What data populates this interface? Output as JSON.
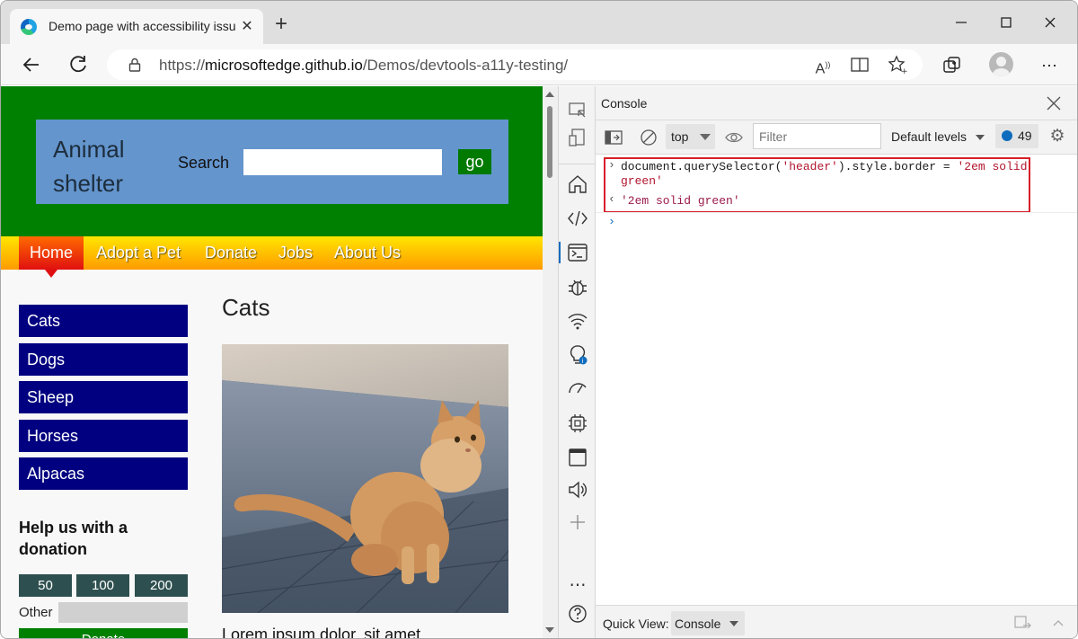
{
  "browser": {
    "tab_title": "Demo page with accessibility issues",
    "tab_close": "✕",
    "new_tab": "+",
    "url_scheme": "https://",
    "url_host": "microsoftedge.github.io",
    "url_path": "/Demos/devtools-a11y-testing/"
  },
  "page": {
    "site_title": "Animal shelter",
    "search_label": "Search",
    "search_value": "",
    "go_label": "go",
    "nav": [
      "Home",
      "Adopt a Pet",
      "Donate",
      "Jobs",
      "About Us"
    ],
    "sidebar": [
      "Cats",
      "Dogs",
      "Sheep",
      "Horses",
      "Alpacas"
    ],
    "donation_title": "Help us with a donation",
    "amounts": [
      "50",
      "100",
      "200"
    ],
    "other_label": "Other",
    "donate_label": "Donate",
    "heading": "Cats",
    "body_text": "Lorem ipsum dolor, sit amet"
  },
  "devtools": {
    "panel_title": "Console",
    "context": "top",
    "filter_placeholder": "Filter",
    "levels": "Default levels",
    "issues_count": "49",
    "input_prefix": "document.querySelector(",
    "input_selector": "'header'",
    "input_middle": ").style.border = ",
    "input_value_1": "'2em solid",
    "input_value_2": "green'",
    "result": "'2em solid green'",
    "quick_view_label": "Quick View:",
    "quick_view_value": "Console"
  },
  "colors": {
    "header_green": "#008000",
    "header_box_blue": "#6495cd",
    "sidebar_navy": "#000080",
    "highlight_red": "#d61f2a"
  }
}
